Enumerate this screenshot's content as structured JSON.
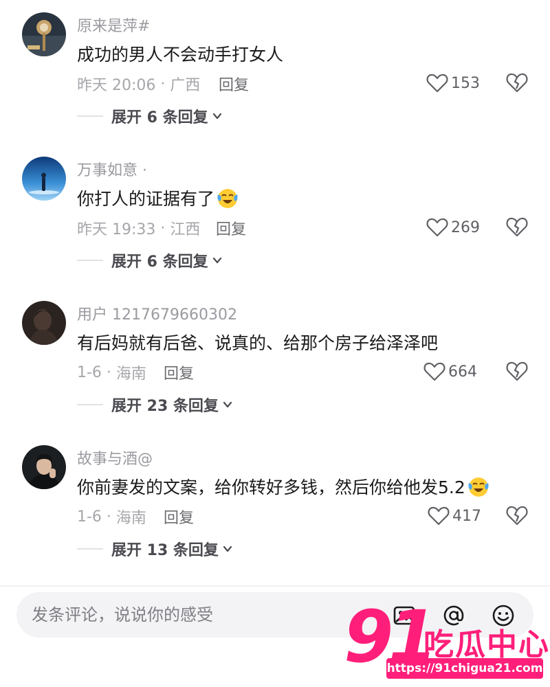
{
  "comments": [
    {
      "username": "原来是萍#",
      "text": "成功的男人不会动手打女人",
      "time": "昨天 20:06",
      "location": "广西",
      "reply_label": "回复",
      "likes": "153",
      "expand_label": "展开 6 条回复",
      "has_emoji": false
    },
    {
      "username": "万事如意 ·",
      "text": "你打人的证据有了",
      "time": "昨天 19:33",
      "location": "江西",
      "reply_label": "回复",
      "likes": "269",
      "expand_label": "展开 6 条回复",
      "has_emoji": true
    },
    {
      "username": "用户 1217679660302",
      "text": "有后妈就有后爸、说真的、给那个房子给泽泽吧",
      "time": "1-6",
      "location": "海南",
      "reply_label": "回复",
      "likes": "664",
      "expand_label": "展开 23 条回复",
      "has_emoji": false
    },
    {
      "username": "故事与酒@",
      "text": "你前妻发的文案，给你转好多钱，然后你给他发5.2",
      "time": "1-6",
      "location": "海南",
      "reply_label": "回复",
      "likes": "417",
      "expand_label": "展开 13 条回复",
      "has_emoji": true
    }
  ],
  "input": {
    "placeholder": "发条评论，说说你的感受"
  },
  "icons": {
    "like": "heart-icon",
    "dislike": "broken-heart-icon",
    "expand": "chevron-down-icon",
    "emoji": "crying-laughing-emoji-icon",
    "image": "image-icon",
    "mention": "at-icon",
    "face": "smiley-icon"
  },
  "watermark": {
    "number": "91",
    "title": "吃瓜中心",
    "url": "https://91chigua21.com"
  },
  "colors": {
    "watermark": "#ff1f7a",
    "muted_text": "#9a9aa0"
  }
}
